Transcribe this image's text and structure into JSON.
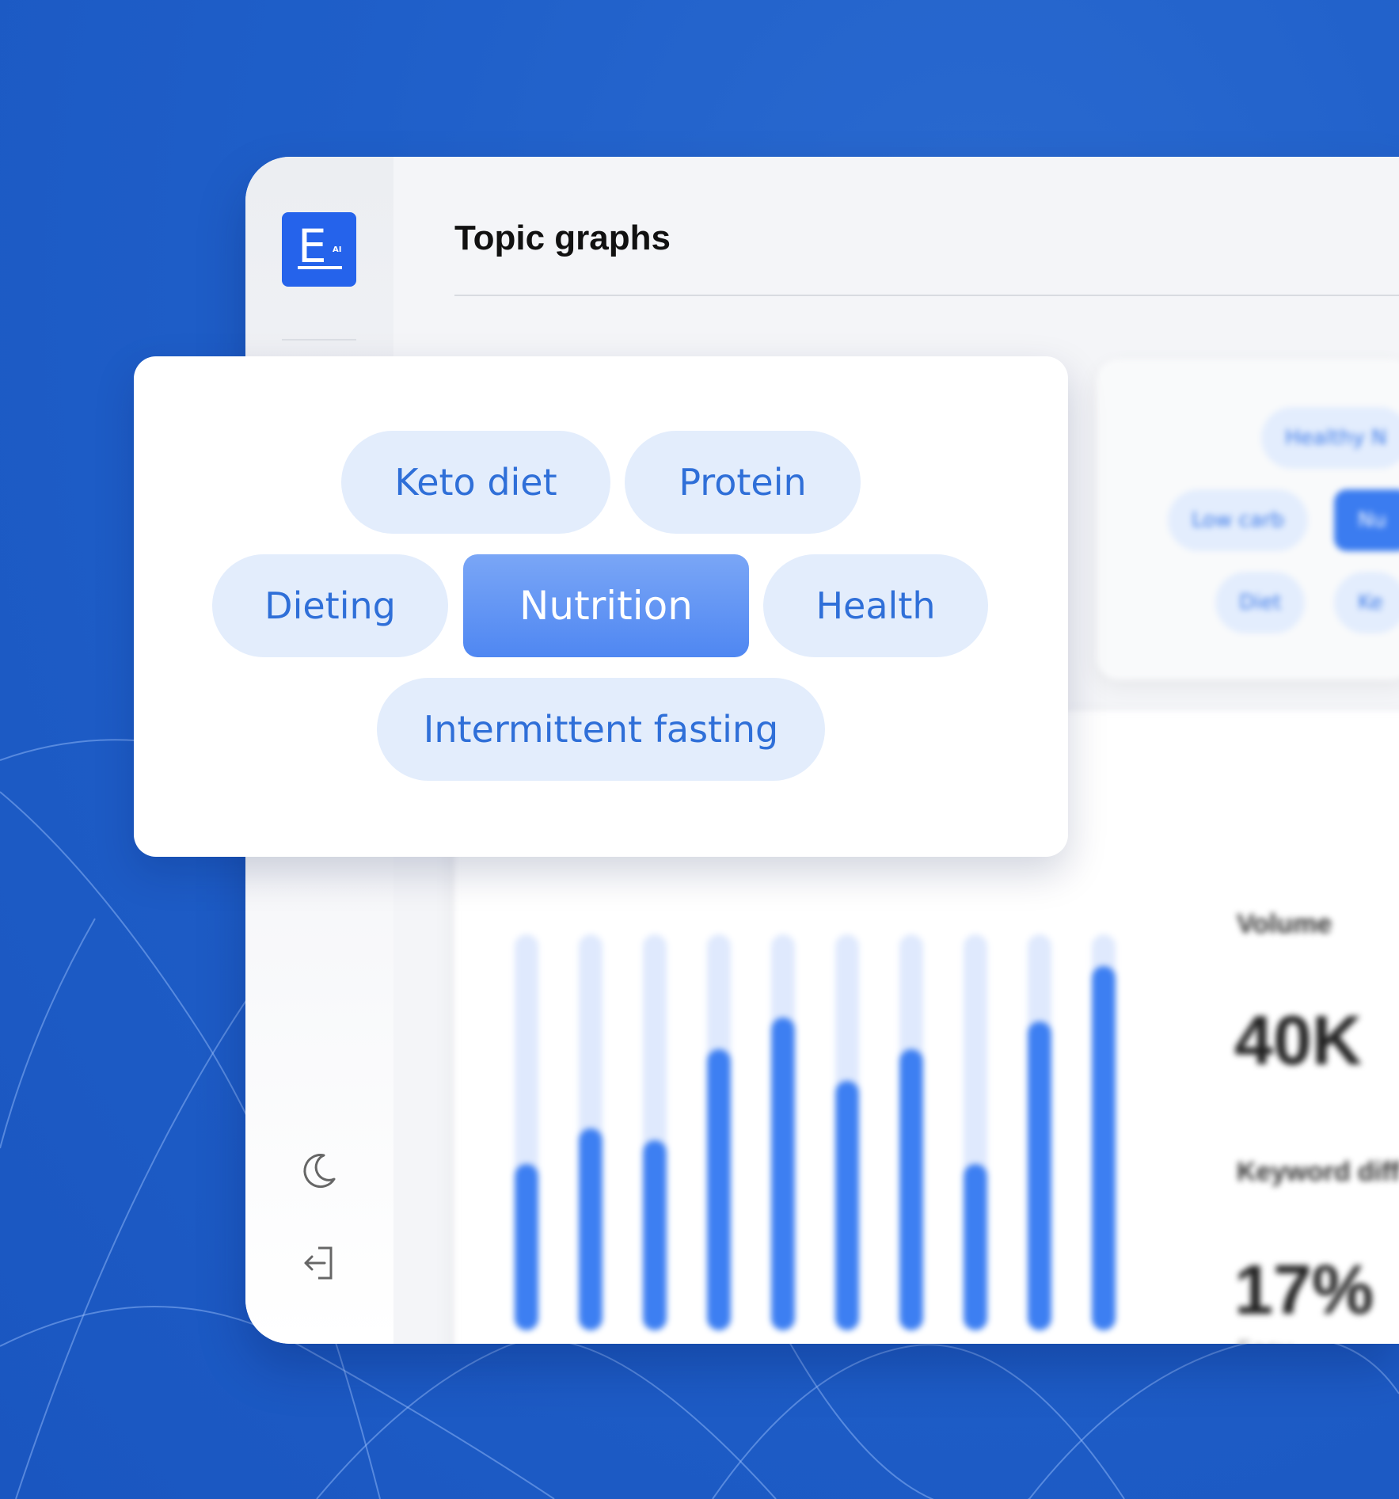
{
  "app": {
    "logo_letter": "E",
    "logo_superscript": "AI"
  },
  "header": {
    "title": "Topic graphs"
  },
  "topics": {
    "chips": [
      {
        "label": "Keto diet",
        "active": false
      },
      {
        "label": "Protein",
        "active": false
      },
      {
        "label": "Dieting",
        "active": false
      },
      {
        "label": "Nutrition",
        "active": true
      },
      {
        "label": "Health",
        "active": false
      },
      {
        "label": "Intermittent fasting",
        "active": false
      }
    ]
  },
  "background_topics": {
    "chips": [
      "Healthy N",
      "Low carb",
      "Nu",
      "Diet",
      "Ke"
    ]
  },
  "stats": {
    "volume_label": "Volume",
    "volume_value": "40K",
    "difficulty_label": "Keyword diff",
    "difficulty_value": "17%",
    "difficulty_rating": "Easy"
  },
  "sidebar": {
    "icons": [
      "moon-icon",
      "logout-icon"
    ]
  },
  "colors": {
    "accent": "#3d7ff2",
    "chip_bg": "#e3edfc",
    "background": "#1f5fc9"
  },
  "chart_data": {
    "type": "bar",
    "title": "",
    "values": [
      0.42,
      0.51,
      0.48,
      0.71,
      0.79,
      0.63,
      0.71,
      0.42,
      0.78,
      0.92
    ],
    "track": [
      1.0,
      1.0,
      1.0,
      1.0,
      1.0,
      1.0,
      1.0,
      1.0,
      1.0,
      1.0
    ]
  }
}
